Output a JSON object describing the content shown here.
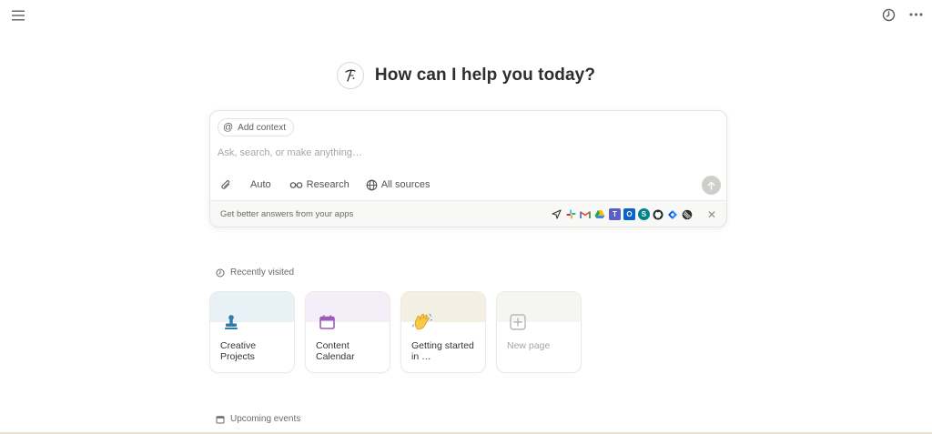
{
  "header": {
    "menu_icon": "hamburger-icon",
    "history_icon": "clock-icon",
    "more_icon": "ellipsis-icon"
  },
  "hero": {
    "title": "How can I help you today?",
    "avatar_icon": "ai-face-icon"
  },
  "composer": {
    "add_context_label": "Add context",
    "input_placeholder": "Ask, search, or make anything…",
    "input_value": "",
    "tools": {
      "attach_icon": "paperclip-icon",
      "auto_label": "Auto",
      "research_label": "Research",
      "sources_label": "All sources"
    },
    "send_icon": "arrow-up-icon",
    "apps_text": "Get better answers from your apps",
    "apps": [
      {
        "name": "send-app-icon",
        "color": "#37352f"
      },
      {
        "name": "slack-icon",
        "color": "#e01e5a"
      },
      {
        "name": "gmail-icon",
        "color": "#ea4335"
      },
      {
        "name": "google-drive-icon",
        "color": "#1fa463"
      },
      {
        "name": "teams-icon",
        "color": "#5b5fc7"
      },
      {
        "name": "outlook-icon",
        "color": "#0a64c9"
      },
      {
        "name": "sharepoint-icon",
        "color": "#038387"
      },
      {
        "name": "github-icon",
        "color": "#24292f"
      },
      {
        "name": "jira-icon",
        "color": "#2684ff"
      },
      {
        "name": "linear-icon",
        "color": "#2f2e2b"
      }
    ],
    "close_icon": "close-icon"
  },
  "recent": {
    "label": "Recently visited",
    "icon": "clock-small-icon",
    "cards": [
      {
        "title": "Creative Projects",
        "band": "#e8f1f6",
        "icon": "stamp-icon"
      },
      {
        "title": "Content Calendar",
        "band": "#f3eef7",
        "icon": "calendar-icon"
      },
      {
        "title": "Getting started in …",
        "band": "#f3f0e3",
        "icon": "waving-hand-icon"
      },
      {
        "title": "New page",
        "band": "#f5f5f4",
        "icon": "plus-square-icon"
      }
    ]
  },
  "upcoming": {
    "label": "Upcoming events",
    "icon": "calendar-small-icon"
  }
}
